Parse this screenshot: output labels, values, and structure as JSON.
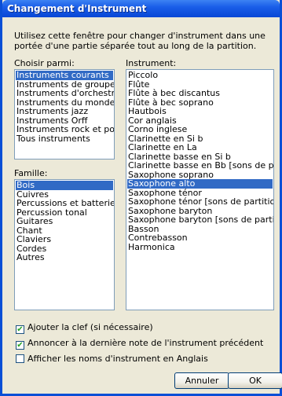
{
  "window": {
    "title": "Changement d'Instrument"
  },
  "intro_text": "Utilisez cette fenêtre pour changer d'instrument dans une portée d'une partie séparée tout au long de la partition.",
  "choose_from": {
    "label": "Choisir parmi:",
    "items": [
      "Instruments courants",
      "Instruments de groupe",
      "Instruments d'orchestre",
      "Instruments du monde",
      "Instruments jazz",
      "Instruments Orff",
      "Instruments rock et pop",
      "Tous instruments"
    ],
    "selected": "Instruments courants"
  },
  "family": {
    "label": "Famille:",
    "items": [
      "Bois",
      "Cuivres",
      "Percussions et batterie",
      "Percussion tonal",
      "Guitares",
      "Chant",
      "Claviers",
      "Cordes",
      "Autres"
    ],
    "selected": "Bois"
  },
  "instrument": {
    "label": "Instrument:",
    "items": [
      "Piccolo",
      "Flûte",
      "Flûte à bec discantus",
      "Flûte à bec soprano",
      "Hautbois",
      "Cor anglais",
      "Corno inglese",
      "Clarinette en Si b",
      "Clarinette en La",
      "Clarinette basse en Si b",
      "Clarinette basse en Bb [sons de partition 8",
      "Saxophone soprano",
      "Saxophone alto",
      "Saxophone ténor",
      "Saxophone ténor [sons de partition 8vb]",
      "Saxophone baryton",
      "Saxophone baryton [sons de partition 8vb]",
      "Basson",
      "Contrebasson",
      "Harmonica"
    ],
    "selected": "Saxophone alto"
  },
  "options": [
    {
      "label": "Ajouter la clef (si nécessaire)",
      "checked": true
    },
    {
      "label": "Annoncer à la dernière note de l'instrument précédent",
      "checked": true
    },
    {
      "label": "Afficher les noms d'instrument en Anglais",
      "checked": false
    }
  ],
  "buttons": {
    "cancel": "Annuler",
    "ok": "OK"
  }
}
